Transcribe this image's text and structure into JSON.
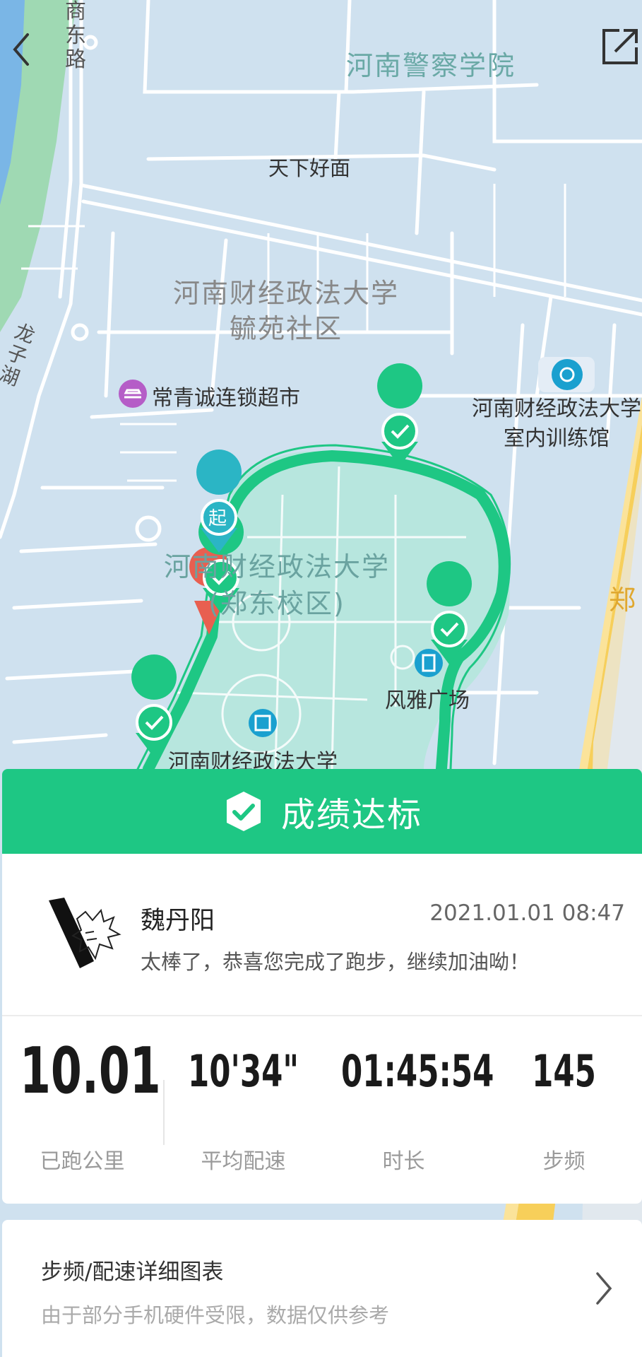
{
  "map": {
    "labels": {
      "road_east": "商东路",
      "police_college": "河南警察学院",
      "noodle": "天下好面",
      "campus_community": "河南财经政法大学\n毓苑社区",
      "road_longzi": "龙子湖",
      "supermarket": "常青诚连锁超市",
      "indoor_gym": "河南财经政法大学\n室内训练馆",
      "east_campus": "河南财经政法大学\n(郑东校区)",
      "plaza": "风雅广场",
      "university_bottom": "河南财经政法大学",
      "zheng": "郑"
    },
    "start_marker": "起",
    "route_color": "#1ec784"
  },
  "header": {
    "back_icon": "chevron-left-icon",
    "share_icon": "share-out-icon"
  },
  "banner": {
    "icon": "check-badge-icon",
    "text": "成绩达标",
    "color": "#1ec784"
  },
  "user": {
    "name": "魏丹阳",
    "datetime": "2021.01.01 08:47",
    "message": "太棒了，恭喜您完成了跑步，继续加油呦！"
  },
  "stats": [
    {
      "value": "10.01",
      "label": "已跑公里"
    },
    {
      "value": "10'34\"",
      "label": "平均配速"
    },
    {
      "value": "01:45:54",
      "label": "时长"
    },
    {
      "value": "145",
      "label": "步频"
    }
  ],
  "chart_link": {
    "title": "步频/配速详细图表",
    "subtitle": "由于部分手机硬件受限，数据仅供参考",
    "icon": "chevron-right-icon"
  }
}
